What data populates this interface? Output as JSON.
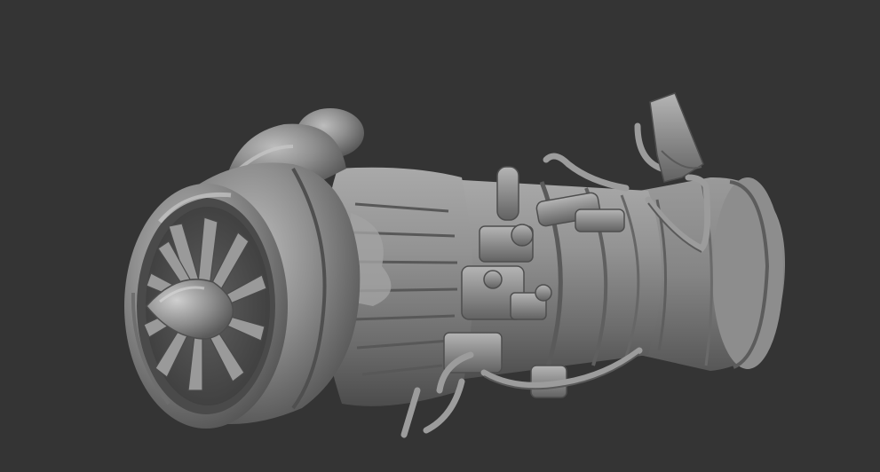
{
  "viewport": {
    "background_color": "#343434",
    "object": "jet-engine-sculpt",
    "material_color": "#8a8a8a",
    "render_style": "clay-matcap"
  }
}
